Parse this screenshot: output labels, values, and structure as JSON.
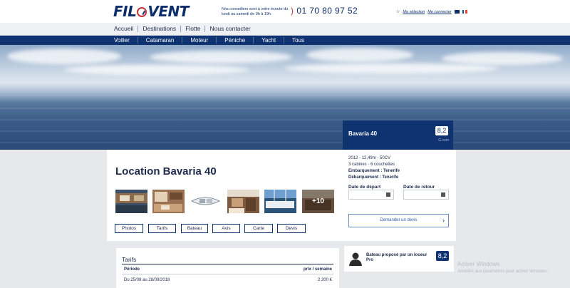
{
  "header": {
    "logo": {
      "part1": "FIL",
      "part2": "VENT"
    },
    "hours": "Nos conseillers sont à votre écoute du lundi au samedi de 9h à 19h",
    "phone": "01 70 80 97 52",
    "selection_link": "Ma sélection",
    "account_link": "Me connecter",
    "flag_colors": [
      "#0055a4",
      "#ffffff",
      "#ef4135"
    ]
  },
  "main_nav": [
    "Accueil",
    "Destinations",
    "Flotte",
    "Nous contacter"
  ],
  "boat_nav": [
    "Voilier",
    "Catamaran",
    "Moteur",
    "Péniche",
    "Yacht",
    "Tous"
  ],
  "boat_card": {
    "name": "Bavaria 40",
    "score": "8,2",
    "source": "G.com"
  },
  "page_title": "Location Bavaria 40",
  "gallery": {
    "more_label": "+10",
    "count": 6
  },
  "tabs": [
    "Photos",
    "Tarifs",
    "Bateau",
    "Avis",
    "Carte",
    "Devis"
  ],
  "specs": {
    "line1": "2012 - 12,49m - 50CV",
    "line2": "3 cabines - 6 couchettes",
    "embark": "Embarquement : Tenerife",
    "disembark": "Débarquement : Tenerife"
  },
  "dates": {
    "departure_label": "Date de départ",
    "return_label": "Date de retour"
  },
  "quote_button": "Demander un devis",
  "tarifs": {
    "heading": "Tarifs",
    "col_period": "Période",
    "col_price": "prix / semaine",
    "rows": [
      {
        "period": "Du 25/08 au 28/09/2018",
        "price": "2 200 €"
      }
    ]
  },
  "pro": {
    "text": "Bateau proposé par un loueur Pro",
    "score": "8,2"
  },
  "watermark": {
    "line1": "Activer Windows",
    "line2": "Accédez aux paramètres pour activer Windows."
  },
  "colors": {
    "navy": "#0f3270",
    "logo_red": "#c3353a"
  }
}
